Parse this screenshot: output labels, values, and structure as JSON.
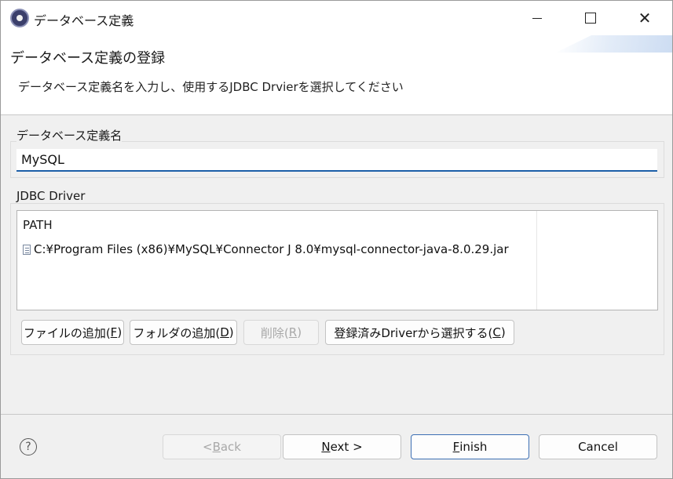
{
  "window": {
    "title": "データベース定義",
    "icon": "eclipse-app-icon"
  },
  "banner": {
    "title": "データベース定義の登録",
    "description": "データベース定義名を入力し、使用するJDBC Drvierを選択してください"
  },
  "name_group": {
    "label": "データベース定義名",
    "value": "MySQL"
  },
  "driver_group": {
    "label": "JDBC Driver",
    "table": {
      "columns": [
        "PATH"
      ],
      "rows": [
        "C:¥Program Files (x86)¥MySQL¥Connector J 8.0¥mysql-connector-java-8.0.29.jar"
      ]
    },
    "buttons": {
      "add_file": {
        "text": "ファイルの追加(",
        "mnemonic": "F",
        "close": ")"
      },
      "add_folder": {
        "text": "フォルダの追加(",
        "mnemonic": "D",
        "close": ")"
      },
      "remove": {
        "text": "削除(",
        "mnemonic": "R",
        "close": ")"
      },
      "select_registered": {
        "text": "登録済みDriverから選択する(",
        "mnemonic": "C",
        "close": ")"
      }
    }
  },
  "footer": {
    "back": {
      "prefix": "< ",
      "mnemonic": "B",
      "rest": "ack"
    },
    "next": {
      "mnemonic": "N",
      "rest": "ext >"
    },
    "finish": {
      "mnemonic": "F",
      "rest": "inish"
    },
    "cancel": "Cancel"
  },
  "colors": {
    "accent": "#1c5fa8",
    "background": "#f0f0f0"
  }
}
